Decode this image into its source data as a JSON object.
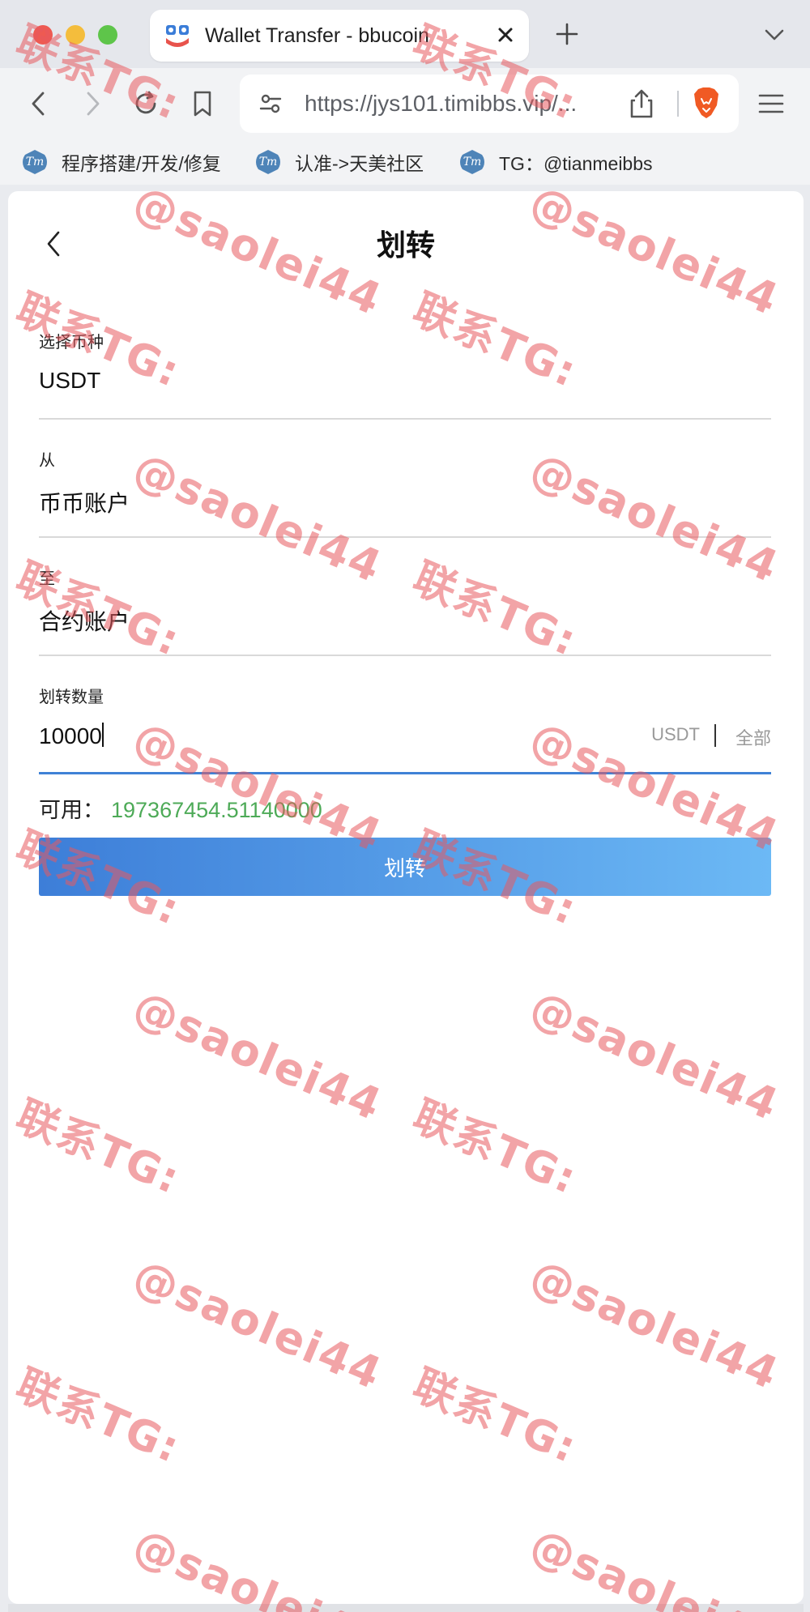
{
  "browser": {
    "tab_title": "Wallet Transfer - bbucoin",
    "url": "https://jys101.timibbs.vip/...",
    "bookmarks": [
      {
        "label": "程序搭建/开发/修复",
        "icon": "Tm"
      },
      {
        "label": "认准->天美社区",
        "icon": "Tm"
      },
      {
        "label": "TG：@tianmeibbs",
        "icon": "Tm"
      }
    ],
    "icons": [
      "favicon-icon",
      "close-icon",
      "plus-icon",
      "chevron-down-icon",
      "back-icon",
      "forward-icon",
      "reload-icon",
      "bookmark-icon",
      "tune-icon",
      "share-icon",
      "brave-lion-icon",
      "hamburger-menu-icon"
    ]
  },
  "page": {
    "title": "划转",
    "back_icon": "chevron-left-icon",
    "fields": {
      "coin": {
        "label": "选择币种",
        "value": "USDT"
      },
      "from": {
        "label": "从",
        "value": "币币账户"
      },
      "to": {
        "label": "至",
        "value": "合约账户"
      },
      "amount": {
        "label": "划转数量",
        "value": "10000",
        "unit": "USDT",
        "all_label": "全部"
      }
    },
    "available": {
      "label": "可用：",
      "value": "197367454.51140000"
    },
    "submit_label": "划转"
  },
  "watermark": {
    "line1": "联系TG:",
    "line2": "@saolei44"
  },
  "colors": {
    "accent_blue": "#3f82d6",
    "button_gradient_start": "#3d7ed8",
    "button_gradient_end": "#6cb9f5",
    "available_green": "#4daa57",
    "watermark_red": "#e85a5f"
  }
}
